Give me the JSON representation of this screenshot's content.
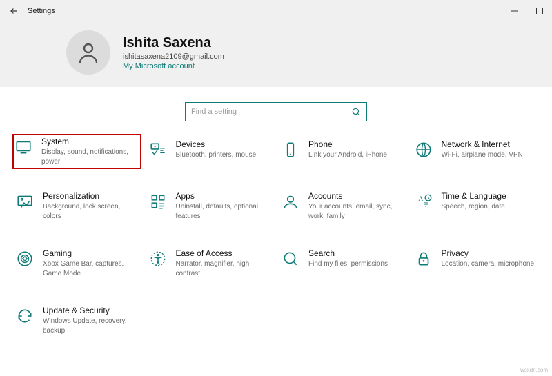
{
  "window": {
    "title": "Settings"
  },
  "user": {
    "name": "Ishita Saxena",
    "email": "ishitasaxena2109@gmail.com",
    "account_link": "My Microsoft account"
  },
  "search": {
    "placeholder": "Find a setting"
  },
  "categories": [
    {
      "icon": "system",
      "title": "System",
      "desc": "Display, sound, notifications, power",
      "highlight": true
    },
    {
      "icon": "devices",
      "title": "Devices",
      "desc": "Bluetooth, printers, mouse"
    },
    {
      "icon": "phone",
      "title": "Phone",
      "desc": "Link your Android, iPhone"
    },
    {
      "icon": "network",
      "title": "Network & Internet",
      "desc": "Wi-Fi, airplane mode, VPN"
    },
    {
      "icon": "personalization",
      "title": "Personalization",
      "desc": "Background, lock screen, colors"
    },
    {
      "icon": "apps",
      "title": "Apps",
      "desc": "Uninstall, defaults, optional features"
    },
    {
      "icon": "accounts",
      "title": "Accounts",
      "desc": "Your accounts, email, sync, work, family"
    },
    {
      "icon": "time",
      "title": "Time & Language",
      "desc": "Speech, region, date"
    },
    {
      "icon": "gaming",
      "title": "Gaming",
      "desc": "Xbox Game Bar, captures, Game Mode"
    },
    {
      "icon": "ease",
      "title": "Ease of Access",
      "desc": "Narrator, magnifier, high contrast"
    },
    {
      "icon": "search",
      "title": "Search",
      "desc": "Find my files, permissions"
    },
    {
      "icon": "privacy",
      "title": "Privacy",
      "desc": "Location, camera, microphone"
    },
    {
      "icon": "update",
      "title": "Update & Security",
      "desc": "Windows Update, recovery, backup"
    }
  ],
  "watermark": "wsxdn.com"
}
